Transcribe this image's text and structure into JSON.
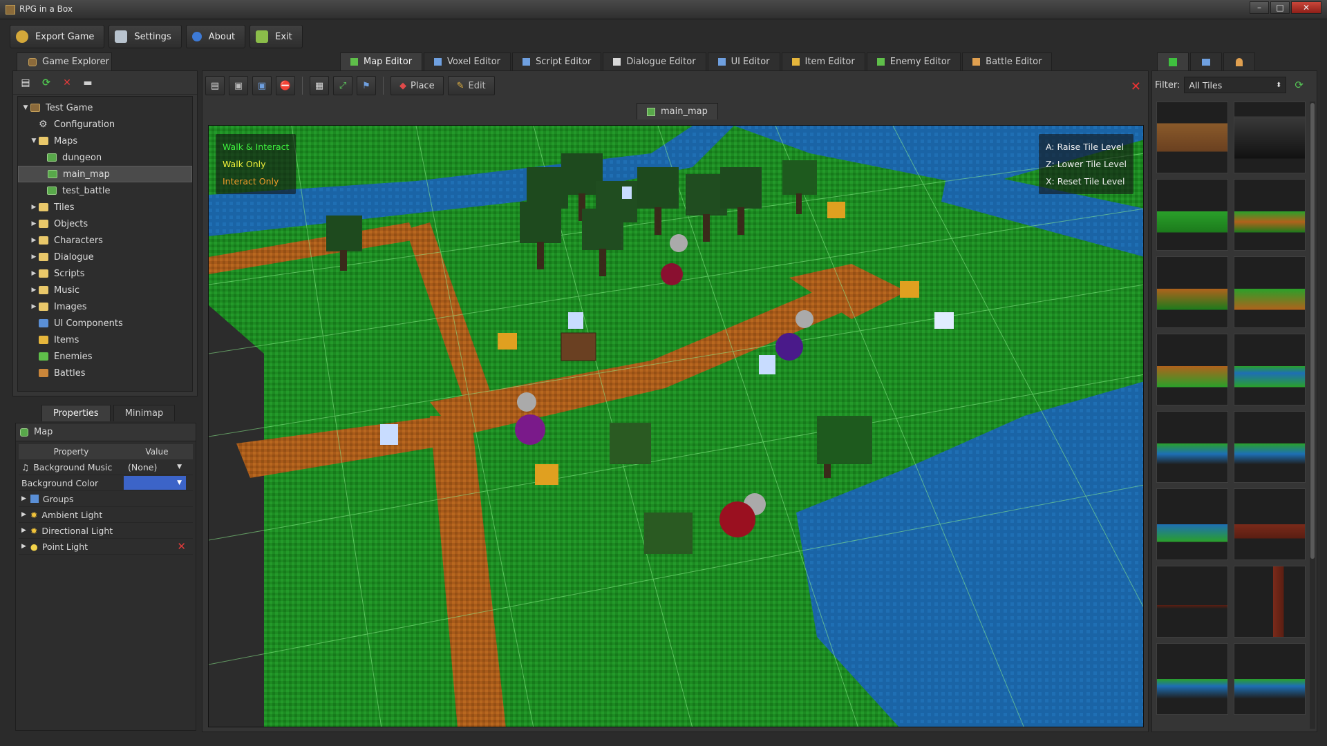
{
  "window": {
    "title": "RPG in a Box",
    "min": "–",
    "max": "□",
    "close": "✕"
  },
  "menu": [
    {
      "label": "Export Game",
      "icon": "export-icon"
    },
    {
      "label": "Settings",
      "icon": "settings-icon"
    },
    {
      "label": "About",
      "icon": "info-icon"
    },
    {
      "label": "Exit",
      "icon": "exit-icon"
    }
  ],
  "explorer": {
    "tab_label": "Game Explorer",
    "tree": [
      {
        "label": "Test Game",
        "depth": 0,
        "arrow": "▼",
        "icon": "game"
      },
      {
        "label": "Configuration",
        "depth": 1,
        "arrow": "",
        "icon": "gear"
      },
      {
        "label": "Maps",
        "depth": 1,
        "arrow": "▼",
        "icon": "folder"
      },
      {
        "label": "dungeon",
        "depth": 2,
        "arrow": "",
        "icon": "map"
      },
      {
        "label": "main_map",
        "depth": 2,
        "arrow": "",
        "icon": "map",
        "selected": true
      },
      {
        "label": "test_battle",
        "depth": 2,
        "arrow": "",
        "icon": "map"
      },
      {
        "label": "Tiles",
        "depth": 1,
        "arrow": "▶",
        "icon": "folder"
      },
      {
        "label": "Objects",
        "depth": 1,
        "arrow": "▶",
        "icon": "folder"
      },
      {
        "label": "Characters",
        "depth": 1,
        "arrow": "▶",
        "icon": "folder"
      },
      {
        "label": "Dialogue",
        "depth": 1,
        "arrow": "▶",
        "icon": "folder"
      },
      {
        "label": "Scripts",
        "depth": 1,
        "arrow": "▶",
        "icon": "folder"
      },
      {
        "label": "Music",
        "depth": 1,
        "arrow": "▶",
        "icon": "folder"
      },
      {
        "label": "Images",
        "depth": 1,
        "arrow": "▶",
        "icon": "folder"
      },
      {
        "label": "UI Components",
        "depth": 1,
        "arrow": "",
        "icon": "ui"
      },
      {
        "label": "Items",
        "depth": 1,
        "arrow": "",
        "icon": "key"
      },
      {
        "label": "Enemies",
        "depth": 1,
        "arrow": "",
        "icon": "enemy"
      },
      {
        "label": "Battles",
        "depth": 1,
        "arrow": "",
        "icon": "battle"
      }
    ]
  },
  "properties": {
    "tabs": [
      "Properties",
      "Minimap"
    ],
    "active_tab": "Properties",
    "title": "Map",
    "col_property": "Property",
    "col_value": "Value",
    "rows": [
      {
        "name": "Background Music",
        "value": "(None)",
        "icon": "music-icon"
      },
      {
        "name": "Background Color",
        "value": "",
        "color": "#3c64c8"
      },
      {
        "name": "Groups",
        "expandable": true,
        "icon": "groups-icon"
      },
      {
        "name": "Ambient Light",
        "expandable": true,
        "icon": "sun-icon"
      },
      {
        "name": "Directional Light",
        "expandable": true,
        "icon": "sun-icon"
      },
      {
        "name": "Point Light",
        "expandable": true,
        "icon": "bulb-icon",
        "deletable": true
      }
    ]
  },
  "editor_tabs": [
    {
      "label": "Map Editor",
      "active": true
    },
    {
      "label": "Voxel Editor"
    },
    {
      "label": "Script Editor"
    },
    {
      "label": "Dialogue Editor"
    },
    {
      "label": "UI Editor"
    },
    {
      "label": "Item Editor"
    },
    {
      "label": "Enemy Editor"
    },
    {
      "label": "Battle Editor"
    }
  ],
  "map_toolbar": {
    "place_label": "Place",
    "edit_label": "Edit"
  },
  "map_tab": "main_map",
  "legend": {
    "walk_interact": "Walk & Interact",
    "walk_only": "Walk Only",
    "interact_only": "Interact Only"
  },
  "keys": {
    "raise": "A: Raise Tile Level",
    "lower": "Z: Lower Tile Level",
    "reset": "X: Reset Tile Level"
  },
  "palette": {
    "filter_label": "Filter:",
    "filter_value": "All Tiles",
    "tiles": 16
  },
  "colors": {
    "grass": "#1f8a1f",
    "path": "#b0621c",
    "water": "#1e6fb4",
    "selected_bg": "#4b4b4b"
  }
}
